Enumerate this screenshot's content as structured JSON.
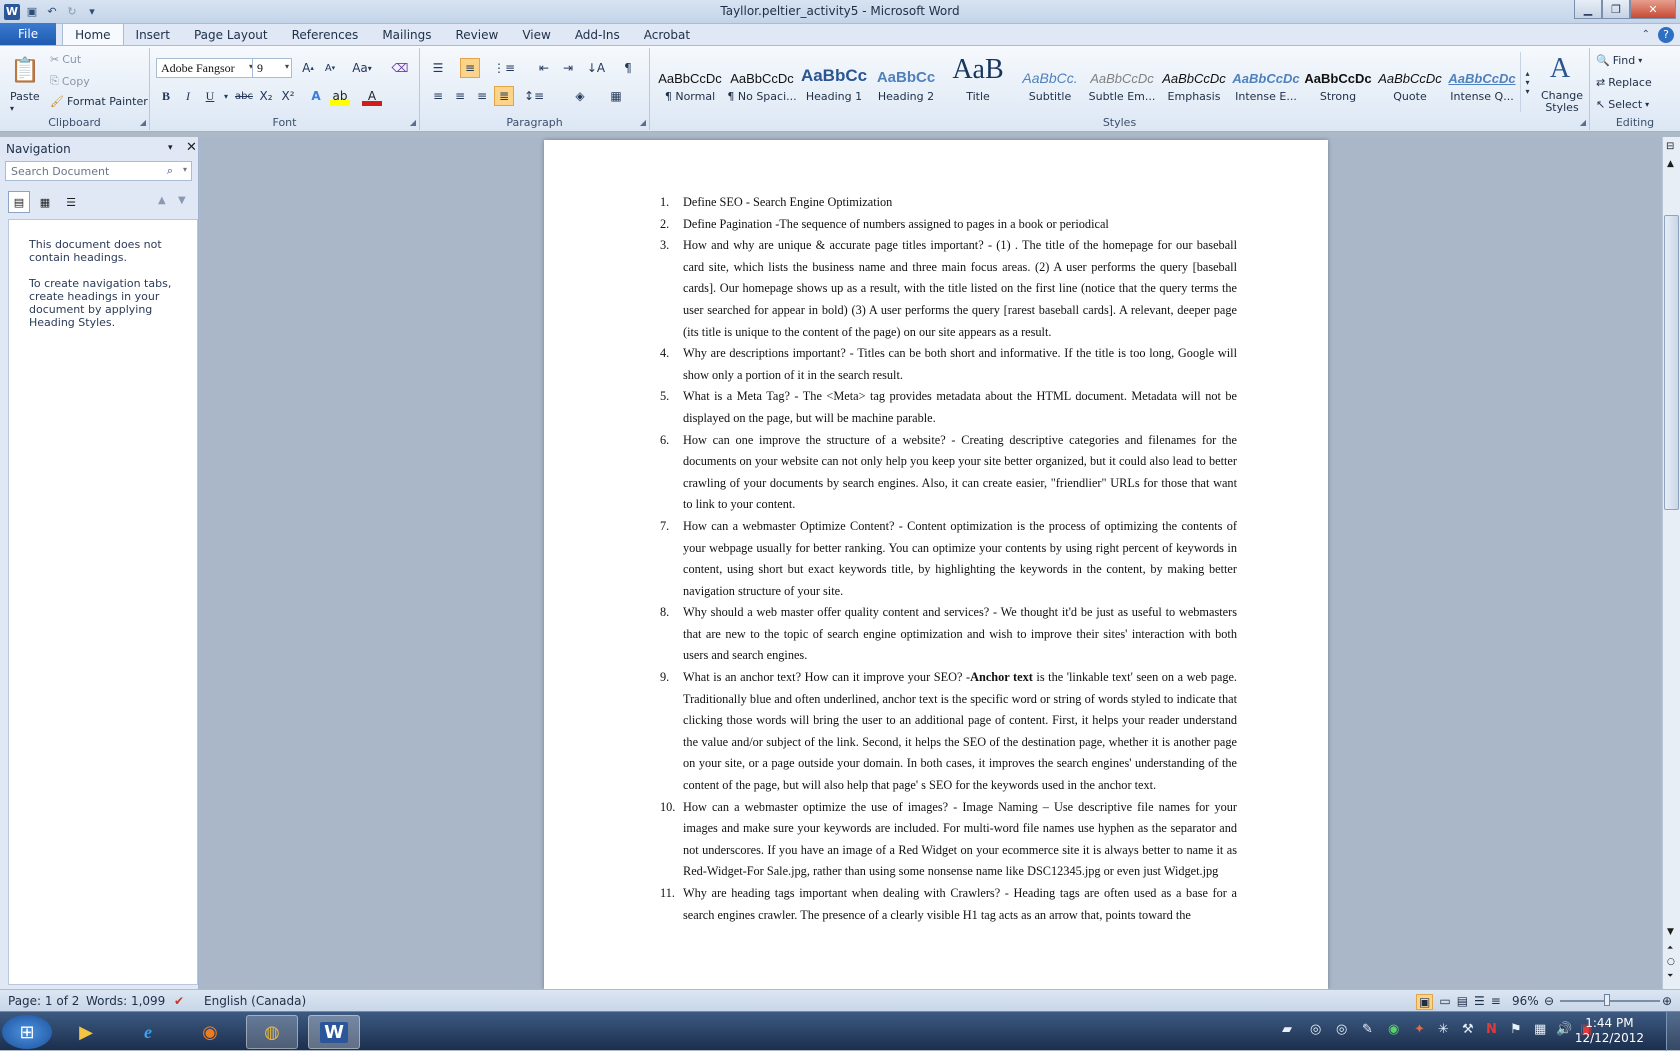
{
  "window": {
    "title": "Tayllor.peltier_activity5  -  Microsoft Word"
  },
  "qat": {
    "save": "save-icon",
    "undo": "undo-icon",
    "redo": "redo-icon"
  },
  "tabs": [
    {
      "label": "File"
    },
    {
      "label": "Home"
    },
    {
      "label": "Insert"
    },
    {
      "label": "Page Layout"
    },
    {
      "label": "References"
    },
    {
      "label": "Mailings"
    },
    {
      "label": "Review"
    },
    {
      "label": "View"
    },
    {
      "label": "Add-Ins"
    },
    {
      "label": "Acrobat"
    }
  ],
  "clipboard": {
    "group": "Clipboard",
    "paste": "Paste",
    "cut": "Cut",
    "copy": "Copy",
    "format_painter": "Format Painter"
  },
  "font": {
    "group": "Font",
    "name": "Adobe Fangsor",
    "size": "9",
    "change_case": "Aa",
    "bold": "B",
    "italic": "I",
    "underline": "U",
    "strike": "abc",
    "sub": "X₂",
    "sup": "X²"
  },
  "paragraph": {
    "group": "Paragraph",
    "show_marks": "¶"
  },
  "styles": {
    "group": "Styles",
    "items": [
      {
        "preview": "AaBbCcDc",
        "name": "¶ Normal"
      },
      {
        "preview": "AaBbCcDc",
        "name": "¶ No Spaci..."
      },
      {
        "preview": "AaBbCc",
        "name": "Heading 1"
      },
      {
        "preview": "AaBbCc",
        "name": "Heading 2"
      },
      {
        "preview": "AaB",
        "name": "Title"
      },
      {
        "preview": "AaBbCc.",
        "name": "Subtitle"
      },
      {
        "preview": "AaBbCcDc",
        "name": "Subtle Em..."
      },
      {
        "preview": "AaBbCcDc",
        "name": "Emphasis"
      },
      {
        "preview": "AaBbCcDc",
        "name": "Intense E..."
      },
      {
        "preview": "AaBbCcDc",
        "name": "Strong"
      },
      {
        "preview": "AaBbCcDc",
        "name": "Quote"
      },
      {
        "preview": "AaBbCcDc",
        "name": "Intense Q..."
      }
    ],
    "change_styles": "Change Styles"
  },
  "editing": {
    "group": "Editing",
    "find": "Find",
    "replace": "Replace",
    "select": "Select"
  },
  "navigation": {
    "title": "Navigation",
    "search_placeholder": "Search Document",
    "msg1": "This document does not contain headings.",
    "msg2": "To create navigation tabs, create headings in your document by applying Heading Styles."
  },
  "document": {
    "items": [
      {
        "num": "1.",
        "text": "Define SEO - Search Engine Optimization"
      },
      {
        "num": "2.",
        "text": "Define Pagination  -The sequence of numbers assigned to pages in a book or periodical"
      },
      {
        "num": "3.",
        "text": "How and why are unique & accurate page titles important? - (1) . The title of the homepage for our baseball card site, which lists the business name and three main focus areas. (2) A user performs the query [baseball cards]. Our homepage shows up as a result, with the title listed on the first line (notice that the query terms the user searched for appear in bold) (3) A user performs the query [rarest baseball cards]. A relevant, deeper page (its title is unique to the content of the page) on our site appears as a result."
      },
      {
        "num": "4.",
        "text": "Why are descriptions important? - Titles can be both short and informative. If the title is too long, Google will show only a portion of it in the search result."
      },
      {
        "num": "5.",
        "text": "What is a Meta Tag? - The <Meta> tag provides metadata about the HTML document. Metadata will not be displayed on the page, but will be machine parable."
      },
      {
        "num": "6.",
        "text": "How can one improve the structure of a website? - Creating descriptive categories and filenames for the documents on your website can not only help you keep your site better organized, but it could also lead to better crawling of your documents by search engines. Also, it can create easier, \"friendlier\" URLs for those that want to link to your content."
      },
      {
        "num": "7.",
        "text": "How can a webmaster Optimize Content? - Content optimization is the process of optimizing the contents of your webpage usually for better ranking. You can optimize your contents by using right percent of keywords in content, using short but exact keywords title, by highlighting the keywords in the content, by making better navigation structure of your site."
      },
      {
        "num": "8.",
        "text": "Why should a web master offer quality content and services? - We thought it'd be just as useful to webmasters that are new to the topic of search engine optimization and wish to improve their sites' interaction with both users and search engines."
      },
      {
        "num": "9.",
        "pre": "What is an anchor text?  How can it improve your SEO? -",
        "bold": "Anchor text",
        "text": " is the 'linkable text' seen on a web page.  Traditionally blue and often underlined, anchor text is the specific word or string of words styled to indicate that clicking those words will bring the user to an additional page of content. First, it helps your reader understand the value and/or subject of the link. Second, it helps the SEO of the destination page, whether it is another page on your site, or a page outside your domain. In both cases, it improves the search engines'  understanding of the content of the page, but will also help that page' s SEO for the keywords used in the anchor text."
      },
      {
        "num": "10.",
        "text": " How can a webmaster optimize the use of images? - Image Naming – Use descriptive file names for your images and make sure your keywords are included. For multi-word file names use hyphen as the separator and not underscores. If you have an image of a Red Widget on your ecommerce site it is always better to name it as Red-Widget-For Sale.jpg, rather than using some nonsense name like DSC12345.jpg or even just Widget.jpg"
      },
      {
        "num": "11.",
        "text": "Why are heading tags important when dealing with Crawlers? - Heading tags are often used as a base for a search engines crawler. The presence of a clearly visible H1 tag acts as an arrow that, points toward the"
      }
    ]
  },
  "status": {
    "page": "Page: 1 of 2",
    "words": "Words: 1,099",
    "language": "English (Canada)",
    "zoom": "96%"
  },
  "taskbar": {
    "time": "1:44 PM",
    "date": "12/12/2012"
  }
}
